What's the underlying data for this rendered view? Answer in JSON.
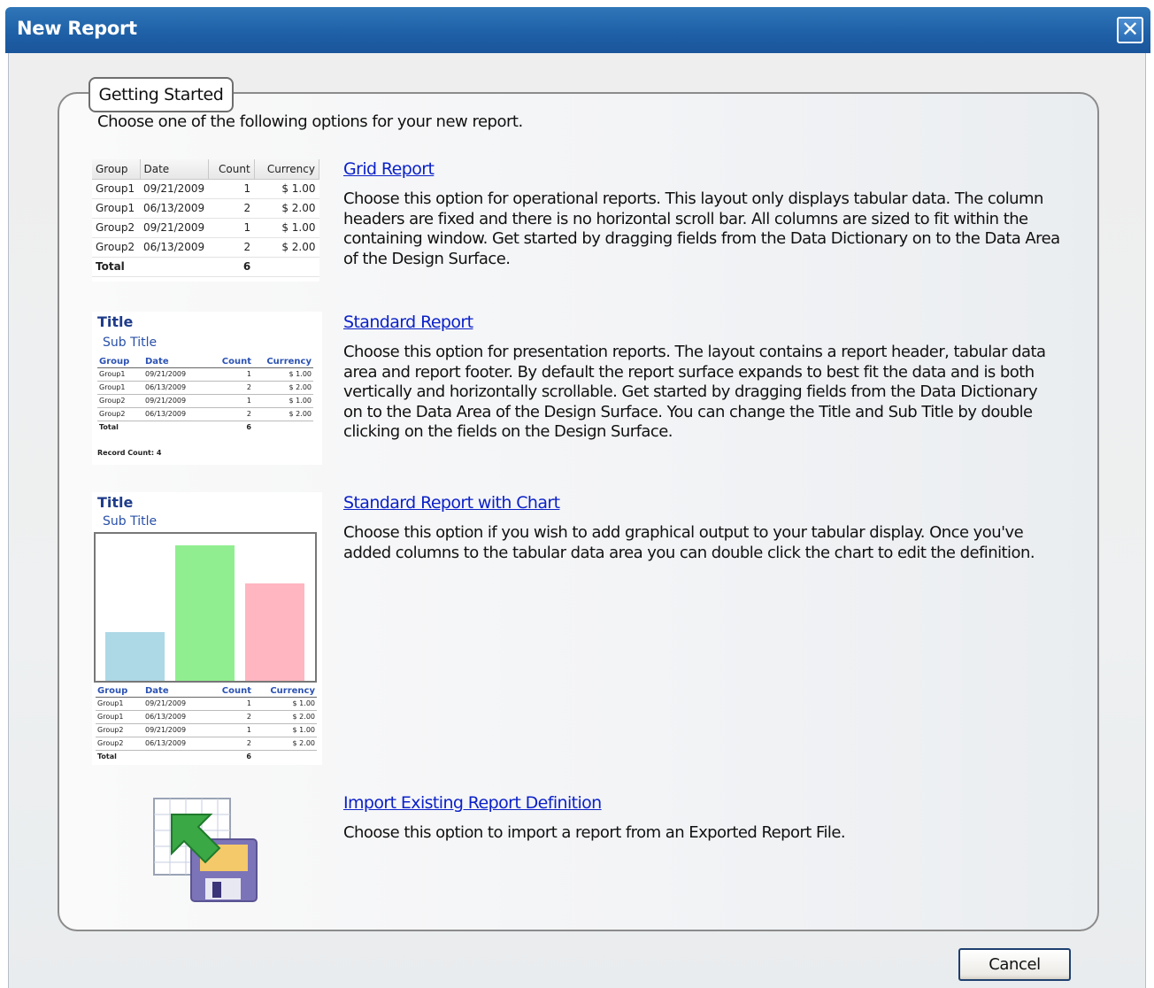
{
  "window": {
    "title": "New Report",
    "close_label": "✕"
  },
  "panel": {
    "legend": "Getting Started",
    "intro": "Choose one of the following options for your new report."
  },
  "options": [
    {
      "link": "Grid Report",
      "description": "Choose this option for operational reports.  This layout only displays tabular data.  The column headers are fixed and there is no horizontal scroll bar.  All columns are sized to fit within the containing window.  Get started by dragging fields from the Data Dictionary on to the Data Area of the Design Surface."
    },
    {
      "link": "Standard Report",
      "description": "Choose this option for presentation reports.  The layout contains a report header, tabular data area and report footer.  By default the report surface expands to best fit the data and is both vertically and horizontally scrollable.  Get started by dragging fields from the Data Dictionary on to the Data Area of the Design Surface.  You can change the Title and Sub Title by double clicking on the fields on the Design Surface."
    },
    {
      "link": "Standard Report with Chart",
      "description": "Choose this option if you wish to add graphical output to your tabular display.  Once you've added columns to the tabular data area you can double click the chart to edit the definition."
    },
    {
      "link": "Import Existing Report Definition",
      "description": "Choose this option to import a report from an Exported Report File."
    }
  ],
  "thumb": {
    "title": "Title",
    "subtitle": "Sub Title",
    "record_count": "Record Count: 4",
    "headers": [
      "Group",
      "Date",
      "Count",
      "Currency"
    ],
    "rows": [
      [
        "Group1",
        "09/21/2009",
        "1",
        "$ 1.00"
      ],
      [
        "Group1",
        "06/13/2009",
        "2",
        "$ 2.00"
      ],
      [
        "Group2",
        "09/21/2009",
        "1",
        "$ 1.00"
      ],
      [
        "Group2",
        "06/13/2009",
        "2",
        "$ 2.00"
      ]
    ],
    "total_label": "Total",
    "total_count": "6"
  },
  "chart_data": {
    "type": "bar",
    "categories": [
      "",
      "",
      ""
    ],
    "values": [
      0.36,
      1.0,
      0.72
    ],
    "colors": [
      "#add8e6",
      "#90ee90",
      "#ffb6c1"
    ]
  },
  "footer": {
    "cancel_label": "Cancel"
  },
  "icons": {
    "close": "close-icon",
    "import": "import-report-icon"
  }
}
